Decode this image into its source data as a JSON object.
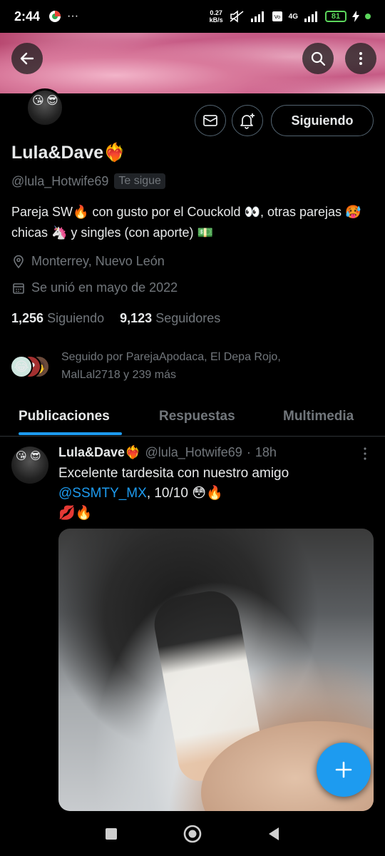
{
  "status_bar": {
    "time": "2:44",
    "more": "···",
    "net_speed_value": "0.27",
    "net_speed_unit": "kB/s",
    "network": "4G",
    "battery": "81"
  },
  "profile": {
    "name": "Lula&Dave❤️‍🔥",
    "handle": "@lula_Hotwife69",
    "follows_you_badge": "Te sigue",
    "bio": "Pareja SW🔥 con gusto por el  Couckold 👀, otras parejas 🥵 chicas 🦄 y singles (con aporte) 💵",
    "location": "Monterrey, Nuevo León",
    "joined": "Se unió en mayo de 2022",
    "following_count": "1,256",
    "following_label": "Siguiendo",
    "followers_count": "9,123",
    "followers_label": "Seguidores",
    "followed_by": "Seguido por ParejaApodaca, El Depa Rojo, MalLal2718 y 239 más"
  },
  "actions": {
    "follow_button": "Siguiendo"
  },
  "tabs": [
    {
      "label": "Publicaciones"
    },
    {
      "label": "Respuestas"
    },
    {
      "label": "Multimedia"
    }
  ],
  "post": {
    "author_name": "Lula&Dave❤️‍🔥",
    "author_handle": "@lula_Hotwife69",
    "dot": "·",
    "time_ago": "18h",
    "text_before": "Excelente tardesita con nuestro amigo ",
    "mention": "@SSMTY_MX",
    "text_after": ", 10/10 😳🔥",
    "text_line2": "💋🔥"
  },
  "colors": {
    "accent": "#1d9bf0",
    "background": "#000000",
    "muted_text": "#71767b",
    "battery_green": "#5cd65c"
  }
}
